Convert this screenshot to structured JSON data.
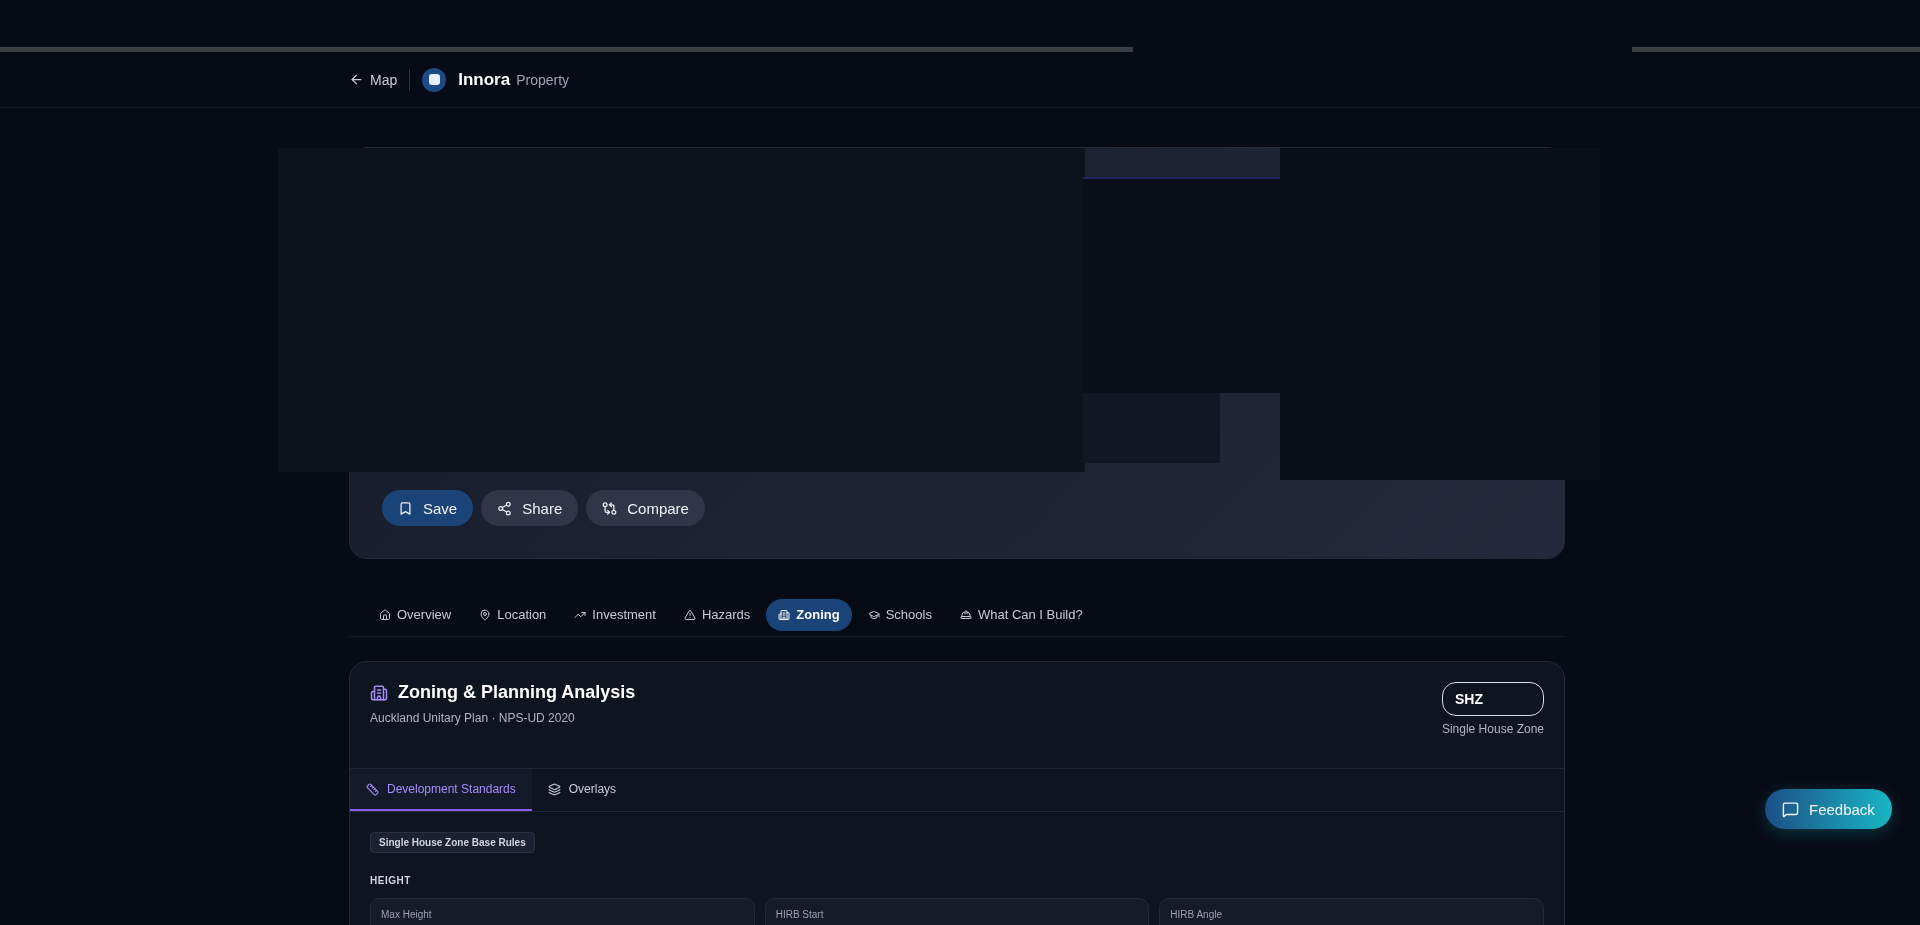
{
  "header": {
    "back_label": "Map",
    "brand": "Innora",
    "brand_sub": "Property"
  },
  "actions": [
    {
      "label": "Save",
      "kind": "primary"
    },
    {
      "label": "Share",
      "kind": "share"
    },
    {
      "label": "Compare",
      "kind": "compare"
    }
  ],
  "tabs": [
    {
      "label": "Overview",
      "kind": "home",
      "selected": false
    },
    {
      "label": "Location",
      "kind": "pin",
      "selected": false
    },
    {
      "label": "Investment",
      "kind": "trend",
      "selected": false
    },
    {
      "label": "Hazards",
      "kind": "warning",
      "selected": false
    },
    {
      "label": "Zoning",
      "kind": "building",
      "selected": true
    },
    {
      "label": "Schools",
      "kind": "school",
      "selected": false
    },
    {
      "label": "What Can I Build?",
      "kind": "helmet",
      "selected": false
    }
  ],
  "zoning": {
    "title": "Zoning & Planning Analysis",
    "subtitle": "Auckland Unitary Plan · NPS-UD 2020",
    "zone_code": "SHZ",
    "zone_name": "Single House Zone",
    "subtabs": [
      {
        "label": "Development Standards",
        "kind": "ruler",
        "selected": true
      },
      {
        "label": "Overlays",
        "kind": "layers",
        "selected": false
      }
    ],
    "rules_tag": "Single House Zone Base Rules",
    "section": "HEIGHT",
    "cards": [
      {
        "label": "Max Height"
      },
      {
        "label": "HIRB Start"
      },
      {
        "label": "HIRB Angle"
      }
    ]
  },
  "feedback": {
    "label": "Feedback"
  }
}
